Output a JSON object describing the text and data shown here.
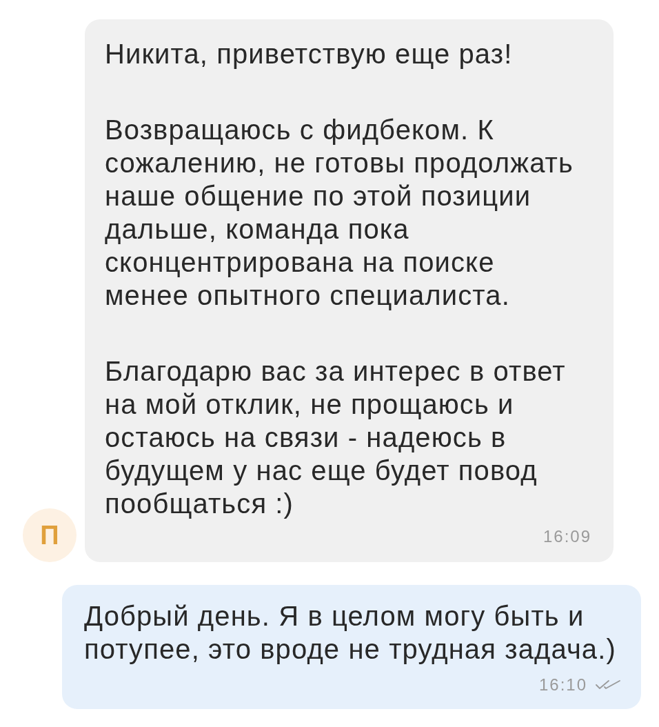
{
  "messages": [
    {
      "kind": "incoming",
      "sender_initial": "П",
      "paragraphs": [
        "Никита, приветствую еще раз!",
        "Возвращаюсь с фидбеком. К\nсожалению, не готовы продолжать\nнаше общение по этой позиции\nдальше, команда пока\nсконцентрирована на поиске\nменее опытного специалиста.",
        "Благодарю вас за интерес в ответ\nна мой отклик, не прощаюсь и\nостаюсь на связи - надеюсь в\nбудущем у нас еще будет повод\nпообщаться :)"
      ],
      "time": "16:09"
    },
    {
      "kind": "outgoing",
      "paragraphs": [
        "Добрый день. Я в целом могу быть и\nпотупее, это вроде не трудная задача.)"
      ],
      "time": "16:10",
      "read": true
    }
  ]
}
